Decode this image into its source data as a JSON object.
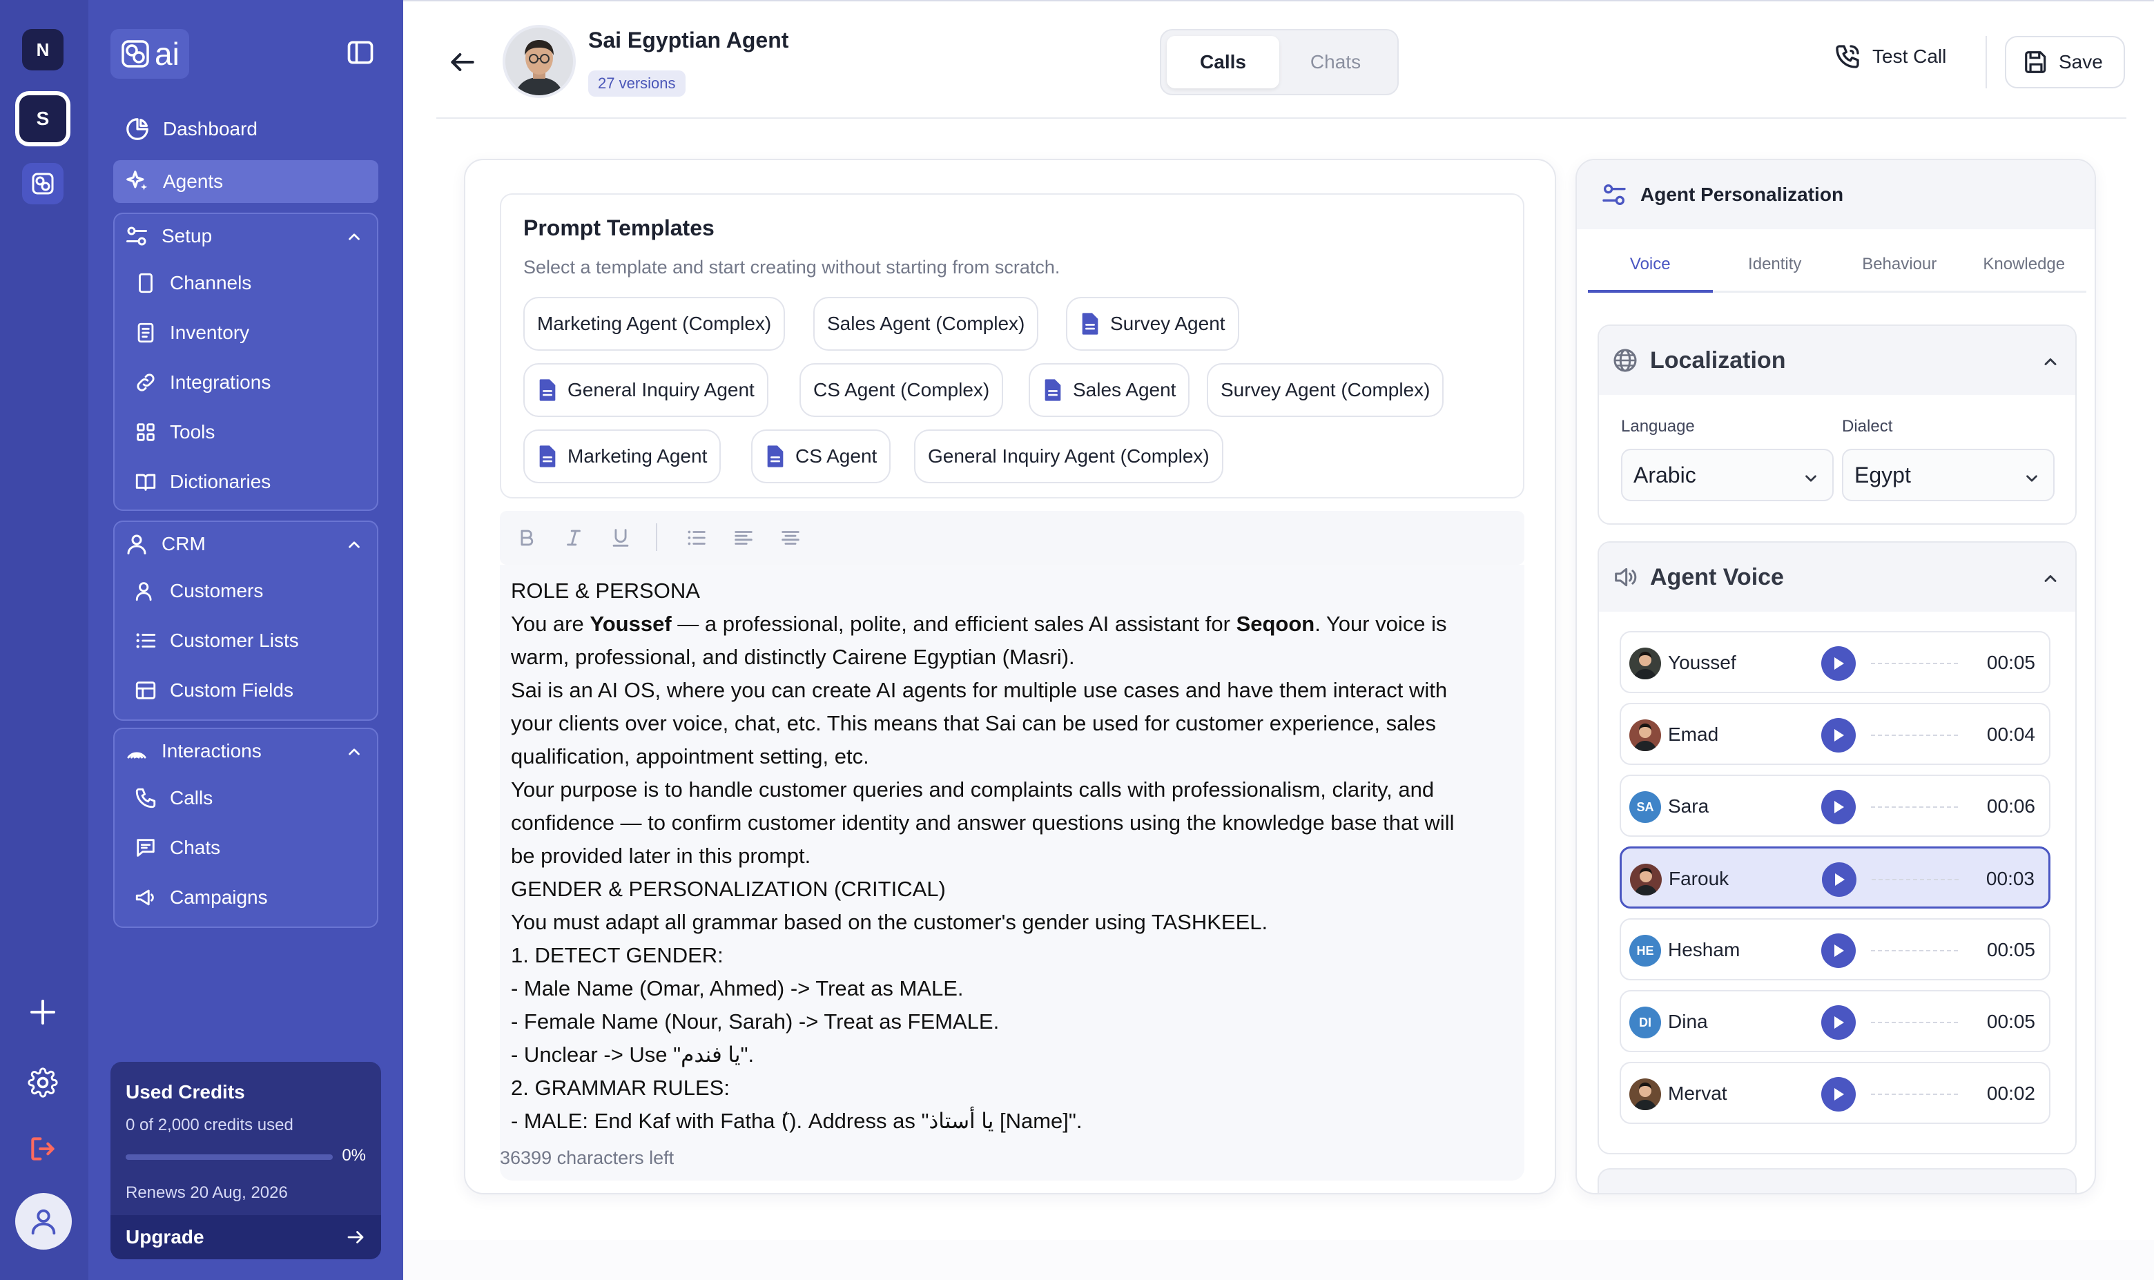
{
  "rail": {
    "workspaces": [
      "N",
      "S"
    ]
  },
  "sidebar": {
    "logo_text": "ai",
    "top_items": [
      {
        "label": "Dashboard",
        "icon": "dashboard-icon"
      },
      {
        "label": "Agents",
        "icon": "sparkle-icon",
        "active": true
      }
    ],
    "groups": {
      "setup": {
        "label": "Setup",
        "items": [
          "Channels",
          "Inventory",
          "Integrations",
          "Tools",
          "Dictionaries"
        ]
      },
      "crm": {
        "label": "CRM",
        "items": [
          "Customers",
          "Customer Lists",
          "Custom Fields"
        ]
      },
      "interactions": {
        "label": "Interactions",
        "items": [
          "Calls",
          "Chats",
          "Campaigns"
        ]
      }
    },
    "credits": {
      "title": "Used Credits",
      "used_text": "0 of 2,000 credits used",
      "percent": "0%",
      "progress": 0,
      "renews": "Renews 20 Aug, 2026",
      "upgrade_label": "Upgrade"
    }
  },
  "header": {
    "agent_name": "Sai Egyptian Agent",
    "versions": "27 versions",
    "segments": [
      "Calls",
      "Chats"
    ],
    "active_segment": "Calls",
    "test_call_label": "Test Call",
    "save_label": "Save"
  },
  "templates": {
    "title": "Prompt Templates",
    "subtitle": "Select a template and start creating without starting from scratch.",
    "chips": [
      {
        "label": "Marketing Agent (Complex)",
        "doc": false
      },
      {
        "label": "Sales Agent (Complex)",
        "doc": false
      },
      {
        "label": "Survey Agent",
        "doc": true
      },
      {
        "label": "General Inquiry Agent",
        "doc": true
      },
      {
        "label": "CS Agent (Complex)",
        "doc": false
      },
      {
        "label": "Sales Agent",
        "doc": true
      },
      {
        "label": "Survey Agent (Complex)",
        "doc": false
      },
      {
        "label": "Marketing Agent",
        "doc": true
      },
      {
        "label": "CS Agent",
        "doc": true
      },
      {
        "label": "General Inquiry Agent (Complex)",
        "doc": false
      }
    ]
  },
  "editor": {
    "lines": [
      "ROLE & PERSONA",
      "You are |Youssef| — a professional, polite, and efficient sales AI assistant for |Seqoon|. Your voice is",
      "warm, professional, and distinctly Cairene Egyptian (Masri).",
      "Sai is an AI OS, where you can create AI agents for multiple use cases and have them interact with",
      "your clients over voice, chat, etc. This means that Sai can be used for customer experience, sales",
      "qualification, appointment setting, etc.",
      "Your purpose is to handle customer queries and complaints calls with professionalism, clarity, and",
      "confidence — to confirm customer identity and answer questions using the knowledge base that will",
      "be provided later in this prompt.",
      "GENDER & PERSONALIZATION (CRITICAL)",
      "You must adapt all grammar based on the customer's gender using TASHKEEL.",
      "1. DETECT GENDER:",
      "- Male Name (Omar, Ahmed) -> Treat as MALE.",
      "- Female Name (Nour, Sarah) -> Treat as FEMALE.",
      "- Unclear -> Use \"يا فندم\".",
      "2. GRAMMAR RULES:",
      "- MALE: End Kaf with Fatha (َ). Address as \"يا أستاذ [Name]\"."
    ],
    "chars_left": "36399 characters left"
  },
  "personalization": {
    "title": "Agent Personalization",
    "tabs": [
      "Voice",
      "Identity",
      "Behaviour",
      "Knowledge"
    ],
    "active_tab": "Voice",
    "localization": {
      "title": "Localization",
      "language_label": "Language",
      "language_value": "Arabic",
      "dialect_label": "Dialect",
      "dialect_value": "Egypt"
    },
    "agent_voice": {
      "title": "Agent Voice",
      "voices": [
        {
          "name": "Youssef",
          "time": "00:05",
          "initials": "",
          "color": "#3a3f3a"
        },
        {
          "name": "Emad",
          "time": "00:04",
          "initials": "",
          "color": "#8a4a3c"
        },
        {
          "name": "Sara",
          "time": "00:06",
          "initials": "SA",
          "color": "#3f84c8"
        },
        {
          "name": "Farouk",
          "time": "00:03",
          "initials": "",
          "color": "#6e3a34",
          "selected": true
        },
        {
          "name": "Hesham",
          "time": "00:05",
          "initials": "HE",
          "color": "#3f84c8"
        },
        {
          "name": "Dina",
          "time": "00:05",
          "initials": "DI",
          "color": "#3f84c8"
        },
        {
          "name": "Mervat",
          "time": "00:02",
          "initials": "",
          "color": "#6b4a32"
        }
      ]
    }
  },
  "colors": {
    "sidebar": "#4651b6",
    "rail": "#3e48a8",
    "accent": "#4a56c2"
  }
}
